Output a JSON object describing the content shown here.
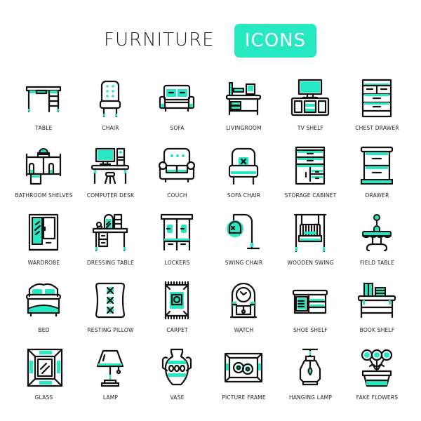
{
  "header": {
    "title": "FURNITURE",
    "badge": "ICONS"
  },
  "colors": {
    "accent": "#26e8c3",
    "stroke": "#111111",
    "text": "#1d1d1f",
    "background": "#ffffff"
  },
  "icons": [
    {
      "label": "TABLE",
      "icon": "table-icon"
    },
    {
      "label": "CHAIR",
      "icon": "chair-icon"
    },
    {
      "label": "SOFA",
      "icon": "sofa-icon"
    },
    {
      "label": "LIVINGROOM",
      "icon": "livingroom-icon"
    },
    {
      "label": "TV SHELF",
      "icon": "tv-shelf-icon"
    },
    {
      "label": "CHEST DRAWER",
      "icon": "chest-drawer-icon"
    },
    {
      "label": "BATHROOM SHELVES",
      "icon": "bathroom-shelves-icon"
    },
    {
      "label": "COMPUTER DESK",
      "icon": "computer-desk-icon"
    },
    {
      "label": "COUCH",
      "icon": "couch-icon"
    },
    {
      "label": "SOFA CHAIR",
      "icon": "sofa-chair-icon"
    },
    {
      "label": "STORAGE CABINET",
      "icon": "storage-cabinet-icon"
    },
    {
      "label": "DRAWER",
      "icon": "drawer-icon"
    },
    {
      "label": "WARDROBE",
      "icon": "wardrobe-icon"
    },
    {
      "label": "DRESSING TABLE",
      "icon": "dressing-table-icon"
    },
    {
      "label": "LOCKERS",
      "icon": "lockers-icon"
    },
    {
      "label": "SWING CHAIR",
      "icon": "swing-chair-icon"
    },
    {
      "label": "WOODEN SWING",
      "icon": "wooden-swing-icon"
    },
    {
      "label": "FIELD TABLE",
      "icon": "field-table-icon"
    },
    {
      "label": "BED",
      "icon": "bed-icon"
    },
    {
      "label": "RESTING PILLOW",
      "icon": "resting-pillow-icon"
    },
    {
      "label": "CARPET",
      "icon": "carpet-icon"
    },
    {
      "label": "WATCH",
      "icon": "watch-icon"
    },
    {
      "label": "SHOE SHELF",
      "icon": "shoe-shelf-icon"
    },
    {
      "label": "BOOK SHELF",
      "icon": "book-shelf-icon"
    },
    {
      "label": "GLASS",
      "icon": "glass-icon"
    },
    {
      "label": "LAMP",
      "icon": "lamp-icon"
    },
    {
      "label": "VASE",
      "icon": "vase-icon"
    },
    {
      "label": "PICTURE FRAME",
      "icon": "picture-frame-icon"
    },
    {
      "label": "HANGING LAMP",
      "icon": "hanging-lamp-icon"
    },
    {
      "label": "FAKE FLOWERS",
      "icon": "fake-flowers-icon"
    }
  ]
}
